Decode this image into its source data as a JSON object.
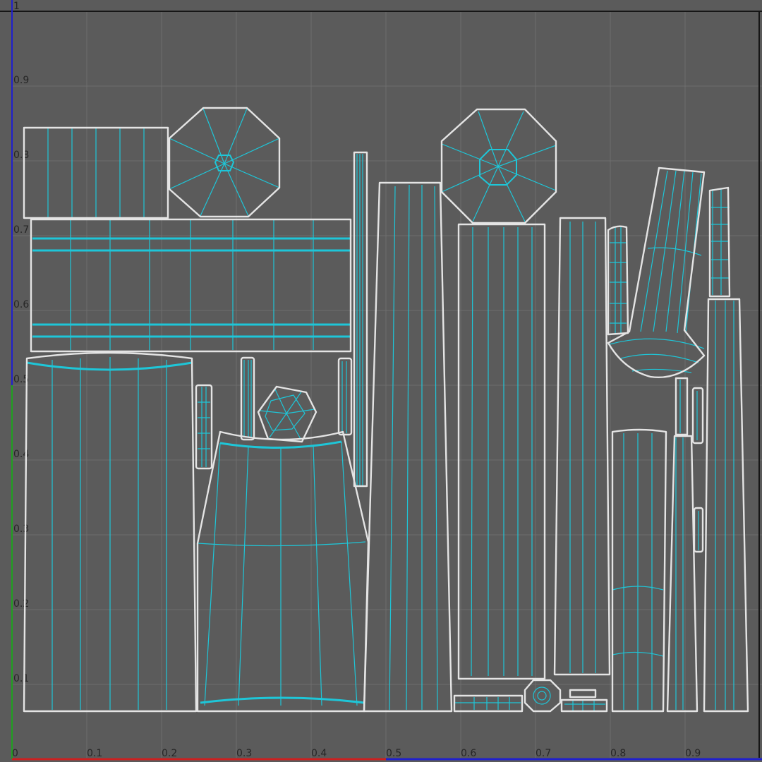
{
  "viewport": {
    "background_color": "#5b5b5b",
    "grid_color": "#6e6e6e",
    "frame_color": "#161616",
    "uv_wire_color": "#1ec6d8",
    "uv_border_color": "#e4e4e4",
    "u_axis_color": "#cc2020",
    "v_axis_color_top": "#2020cc",
    "v_axis_color_bottom": "#20a020"
  },
  "axes": {
    "u_ticks": [
      "0",
      "0.1",
      "0.2",
      "0.3",
      "0.4",
      "0.5",
      "0.6",
      "0.7",
      "0.8",
      "0.9"
    ],
    "v_ticks": [
      "0.9",
      "0.8",
      "0.7",
      "0.6",
      "0.5",
      "0.4",
      "0.3",
      "0.2",
      "0.1"
    ],
    "corner_label": "1"
  }
}
